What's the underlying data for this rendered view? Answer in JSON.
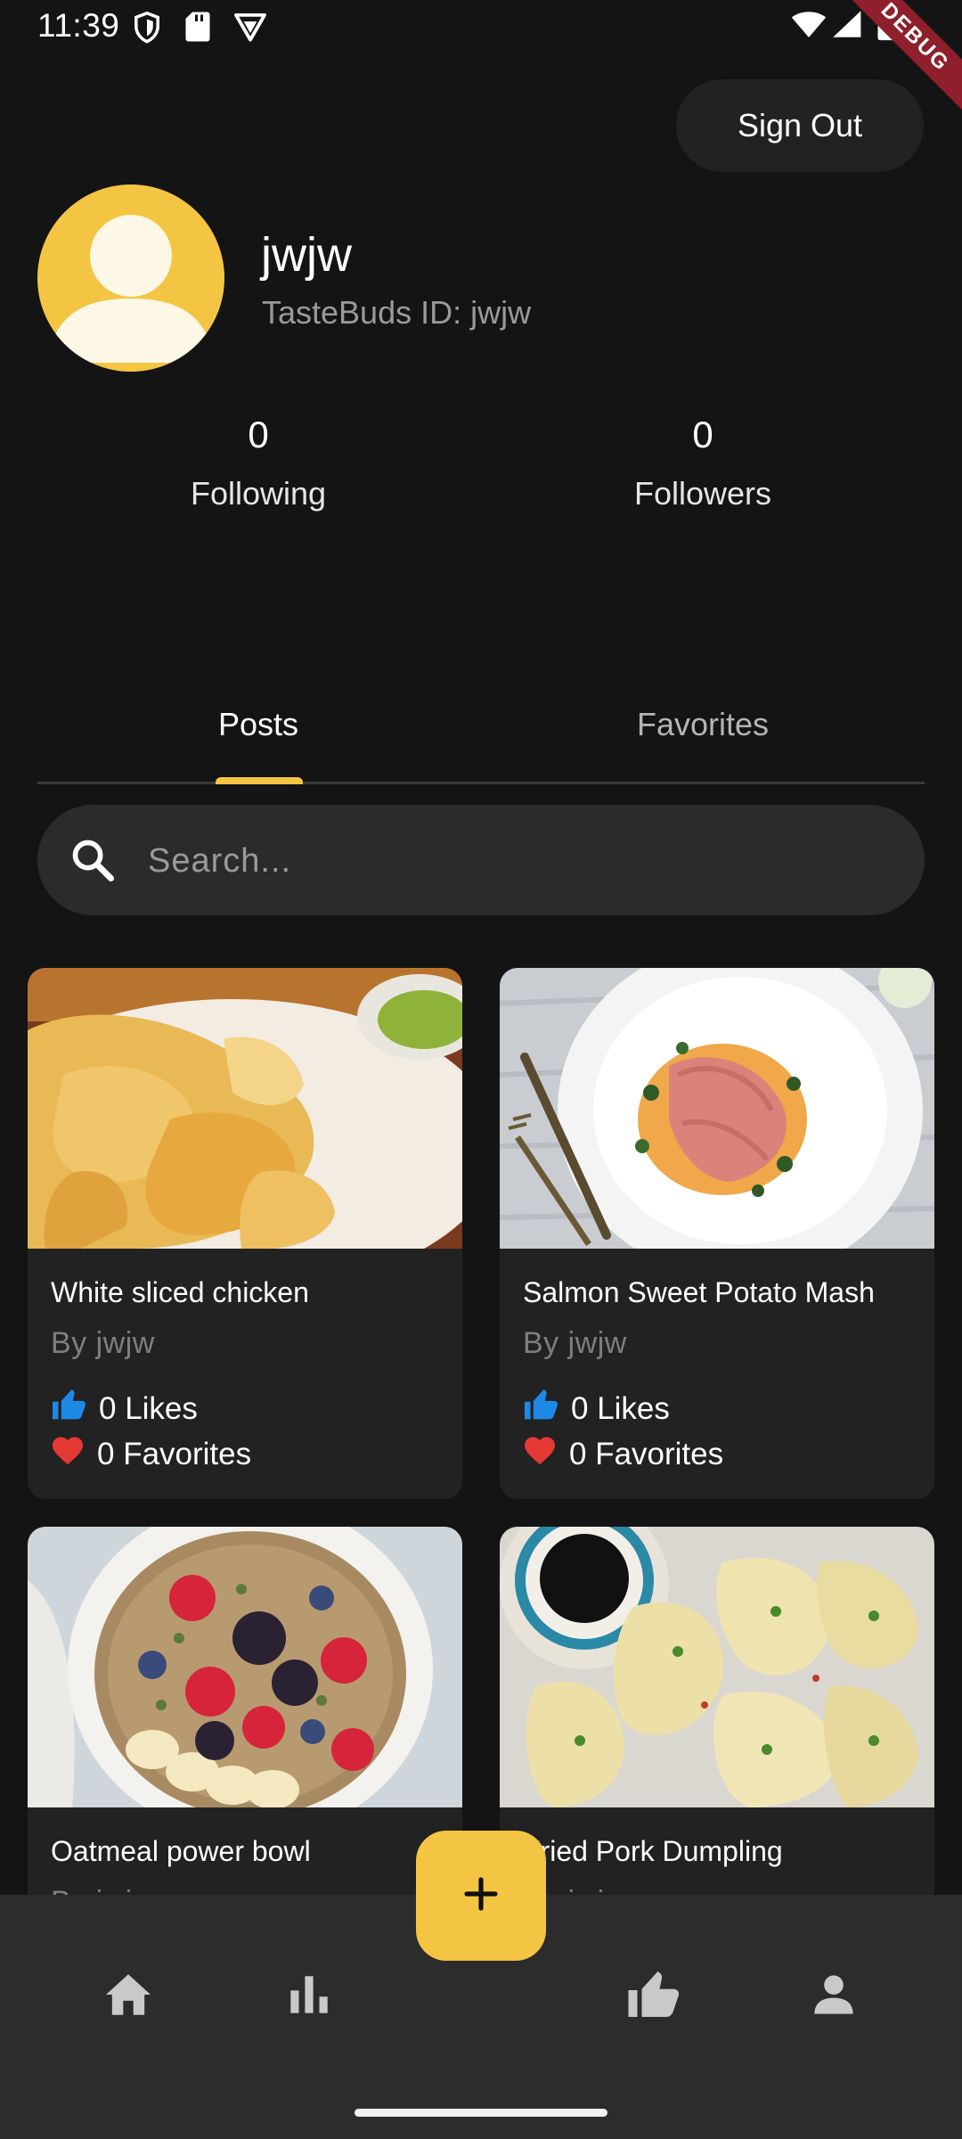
{
  "status_bar": {
    "time": "11:39"
  },
  "debug_banner": "DEBUG",
  "header": {
    "sign_out_label": "Sign Out"
  },
  "profile": {
    "username": "jwjw",
    "id_text": "TasteBuds ID: jwjw",
    "stats": [
      {
        "value": "0",
        "label": "Following"
      },
      {
        "value": "0",
        "label": "Followers"
      }
    ]
  },
  "tabs": [
    {
      "label": "Posts",
      "active": true
    },
    {
      "label": "Favorites",
      "active": false
    }
  ],
  "search": {
    "placeholder": "Search..."
  },
  "posts": [
    {
      "title": "White sliced chicken",
      "author": "By jwjw",
      "likes": "0 Likes",
      "favorites": "0 Favorites",
      "image": "sliced chicken on white plate"
    },
    {
      "title": "Salmon Sweet Potato Mash",
      "author": "By jwjw",
      "likes": "0 Likes",
      "favorites": "0 Favorites",
      "image": "salmon fillet on mash with knife and fork"
    },
    {
      "title": "Oatmeal power bowl",
      "author": "By jwjw",
      "likes": "",
      "favorites": "",
      "image": "oatmeal bowl with berries and banana"
    },
    {
      "title": "Fried Pork Dumpling",
      "author": "By jwjw",
      "likes": "",
      "favorites": "",
      "image": "dumplings with soy sauce dish"
    }
  ],
  "bottom_nav": {
    "items": [
      "home-icon",
      "bar-chart-icon",
      "add-icon",
      "thumbs-up-icon",
      "person-icon"
    ]
  },
  "colors": {
    "background": "#141414",
    "accent": "#f4c542",
    "card": "#222222",
    "like_blue": "#1e88e5",
    "favorite_red": "#e53935"
  }
}
